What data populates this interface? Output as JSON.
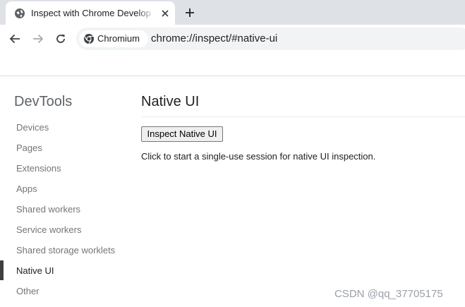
{
  "browser": {
    "tab": {
      "title": "Inspect with Chrome Develop",
      "favicon": "globe-icon",
      "close_icon": "close-icon"
    },
    "new_tab_icon": "plus-icon",
    "toolbar": {
      "back_icon": "back-arrow-icon",
      "forward_icon": "forward-arrow-icon",
      "reload_icon": "reload-icon"
    },
    "omnibox": {
      "chip_label": "Chromium",
      "chip_icon": "chromium-icon",
      "url": "chrome://inspect/#native-ui"
    }
  },
  "sidebar": {
    "title": "DevTools",
    "items": [
      {
        "label": "Devices",
        "selected": false
      },
      {
        "label": "Pages",
        "selected": false
      },
      {
        "label": "Extensions",
        "selected": false
      },
      {
        "label": "Apps",
        "selected": false
      },
      {
        "label": "Shared workers",
        "selected": false
      },
      {
        "label": "Service workers",
        "selected": false
      },
      {
        "label": "Shared storage worklets",
        "selected": false
      },
      {
        "label": "Native UI",
        "selected": true
      },
      {
        "label": "Other",
        "selected": false
      }
    ]
  },
  "main": {
    "title": "Native UI",
    "button_label": "Inspect Native UI",
    "description": "Click to start a single-use session for native UI inspection."
  },
  "watermark": "CSDN @qq_37705175",
  "colors": {
    "tabstrip_bg": "#dee1e6",
    "omnibox_bg": "#f1f3f4",
    "selected_indicator": "#3c4043",
    "sidebar_text": "#757575"
  }
}
